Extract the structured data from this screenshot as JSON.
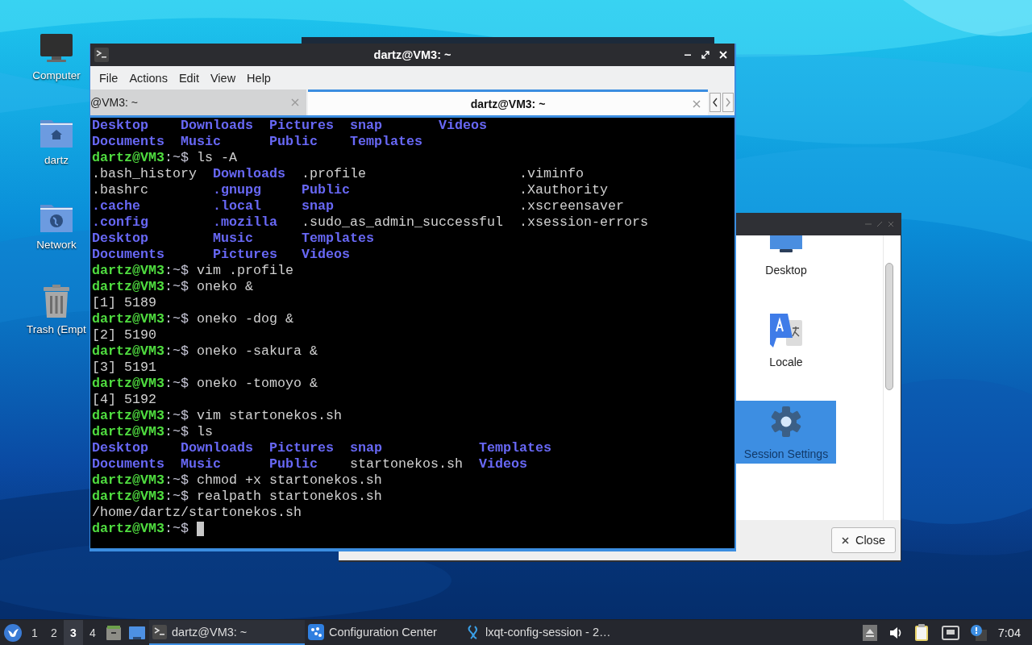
{
  "desktop": {
    "icons": [
      {
        "label": "Computer",
        "kind": "computer"
      },
      {
        "label": "dartz",
        "kind": "home"
      },
      {
        "label": "Network",
        "kind": "network"
      },
      {
        "label": "Trash (Empt",
        "kind": "trash"
      }
    ]
  },
  "config_window": {
    "items": [
      {
        "label": "Desktop",
        "kind": "desktop",
        "selected": false
      },
      {
        "label": "Locale",
        "kind": "locale",
        "selected": false
      },
      {
        "label": "Session Settings",
        "kind": "session",
        "selected": true
      }
    ],
    "close_button": "Close"
  },
  "terminal": {
    "title": "dartz@VM3: ~",
    "menu": [
      "File",
      "Actions",
      "Edit",
      "View",
      "Help"
    ],
    "tabs": [
      {
        "label": "@VM3: ~",
        "selected": false
      },
      {
        "label": "dartz@VM3: ~",
        "selected": true
      }
    ],
    "cursor": true,
    "lines": [
      {
        "kind": "listing",
        "rows": [
          [
            {
              "name": "Desktop",
              "kind": "dir"
            },
            {
              "name": "Downloads",
              "kind": "dir"
            },
            {
              "name": "Pictures",
              "kind": "dir"
            },
            {
              "name": "snap",
              "kind": "dir"
            },
            {
              "name": "Videos",
              "kind": "dir"
            }
          ],
          [
            {
              "name": "Documents",
              "kind": "dir"
            },
            {
              "name": "Music",
              "kind": "dir"
            },
            {
              "name": "Public",
              "kind": "dir"
            },
            {
              "name": "Templates",
              "kind": "dir"
            }
          ]
        ]
      },
      {
        "kind": "prompt",
        "user": "dartz@VM3",
        "sep": ":~$",
        "command": "ls -A"
      },
      {
        "kind": "listing",
        "rows": [
          [
            {
              "name": ".bash_history",
              "kind": "file"
            },
            {
              "name": "Downloads",
              "kind": "dir"
            },
            {
              "name": ".profile",
              "kind": "file"
            },
            {
              "name": ".viminfo",
              "kind": "file"
            }
          ],
          [
            {
              "name": ".bashrc",
              "kind": "file"
            },
            {
              "name": ".gnupg",
              "kind": "dir"
            },
            {
              "name": "Public",
              "kind": "dir"
            },
            {
              "name": ".Xauthority",
              "kind": "file"
            }
          ],
          [
            {
              "name": ".cache",
              "kind": "dir"
            },
            {
              "name": ".local",
              "kind": "dir"
            },
            {
              "name": "snap",
              "kind": "dir"
            },
            {
              "name": ".xscreensaver",
              "kind": "file"
            }
          ],
          [
            {
              "name": ".config",
              "kind": "dir"
            },
            {
              "name": ".mozilla",
              "kind": "dir"
            },
            {
              "name": ".sudo_as_admin_successful",
              "kind": "file"
            },
            {
              "name": ".xsession-errors",
              "kind": "file"
            }
          ],
          [
            {
              "name": "Desktop",
              "kind": "dir"
            },
            {
              "name": "Music",
              "kind": "dir"
            },
            {
              "name": "Templates",
              "kind": "dir"
            }
          ],
          [
            {
              "name": "Documents",
              "kind": "dir"
            },
            {
              "name": "Pictures",
              "kind": "dir"
            },
            {
              "name": "Videos",
              "kind": "dir"
            }
          ]
        ]
      },
      {
        "kind": "prompt",
        "user": "dartz@VM3",
        "sep": ":~$",
        "command": "vim .profile"
      },
      {
        "kind": "prompt",
        "user": "dartz@VM3",
        "sep": ":~$",
        "command": "oneko &"
      },
      {
        "kind": "output",
        "text": "[1] 5189"
      },
      {
        "kind": "prompt",
        "user": "dartz@VM3",
        "sep": ":~$",
        "command": "oneko -dog &"
      },
      {
        "kind": "output",
        "text": "[2] 5190"
      },
      {
        "kind": "prompt",
        "user": "dartz@VM3",
        "sep": ":~$",
        "command": "oneko -sakura &"
      },
      {
        "kind": "output",
        "text": "[3] 5191"
      },
      {
        "kind": "prompt",
        "user": "dartz@VM3",
        "sep": ":~$",
        "command": "oneko -tomoyo &"
      },
      {
        "kind": "output",
        "text": "[4] 5192"
      },
      {
        "kind": "prompt",
        "user": "dartz@VM3",
        "sep": ":~$",
        "command": "vim startonekos.sh"
      },
      {
        "kind": "prompt",
        "user": "dartz@VM3",
        "sep": ":~$",
        "command": "ls"
      },
      {
        "kind": "listing",
        "rows": [
          [
            {
              "name": "Desktop",
              "kind": "dir"
            },
            {
              "name": "Downloads",
              "kind": "dir"
            },
            {
              "name": "Pictures",
              "kind": "dir"
            },
            {
              "name": "snap",
              "kind": "dir"
            },
            {
              "name": "Templates",
              "kind": "dir"
            }
          ],
          [
            {
              "name": "Documents",
              "kind": "dir"
            },
            {
              "name": "Music",
              "kind": "dir"
            },
            {
              "name": "Public",
              "kind": "dir"
            },
            {
              "name": "startonekos.sh",
              "kind": "file"
            },
            {
              "name": "Videos",
              "kind": "dir"
            }
          ]
        ]
      },
      {
        "kind": "prompt",
        "user": "dartz@VM3",
        "sep": ":~$",
        "command": "chmod +x startonekos.sh"
      },
      {
        "kind": "prompt",
        "user": "dartz@VM3",
        "sep": ":~$",
        "command": "realpath startonekos.sh"
      },
      {
        "kind": "output",
        "text": "/home/dartz/startonekos.sh"
      },
      {
        "kind": "prompt",
        "user": "dartz@VM3",
        "sep": ":~$"
      }
    ]
  },
  "taskbar": {
    "desktops": [
      {
        "label": "1",
        "selected": false
      },
      {
        "label": "2",
        "selected": false
      },
      {
        "label": "3",
        "selected": true
      },
      {
        "label": "4",
        "selected": false
      }
    ],
    "tasks": [
      {
        "label": "dartz@VM3: ~",
        "kind": "terminal",
        "selected": true
      },
      {
        "label": "Configuration Center",
        "kind": "config",
        "selected": false
      },
      {
        "label": "lxqt-config-session - 2…",
        "kind": "session",
        "selected": false
      }
    ],
    "clock": "7:04"
  }
}
